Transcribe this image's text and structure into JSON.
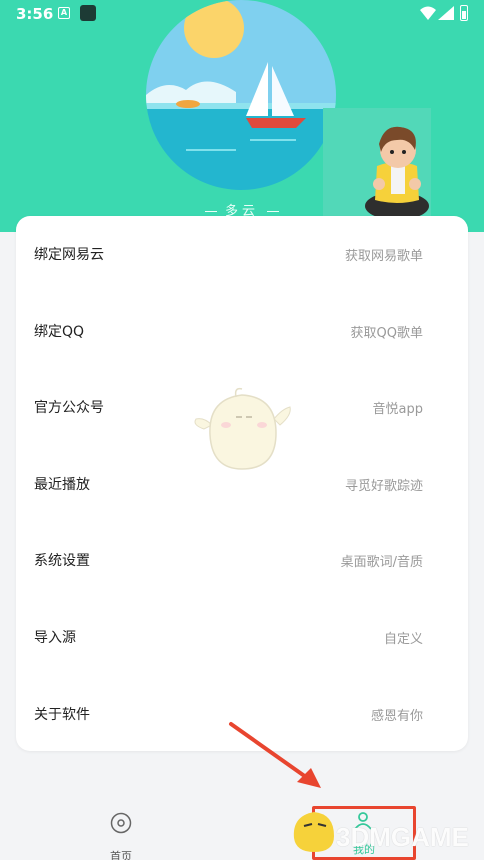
{
  "status_bar": {
    "time": "3:56",
    "notification_letter": "A"
  },
  "weather": {
    "label": "多云"
  },
  "menu": [
    {
      "label": "绑定网易云",
      "value": "获取网易歌单"
    },
    {
      "label": "绑定QQ",
      "value": "获取QQ歌单"
    },
    {
      "label": "官方公众号",
      "value": "音悦app"
    },
    {
      "label": "最近播放",
      "value": "寻觅好歌踪迹"
    },
    {
      "label": "系统设置",
      "value": "桌面歌词/音质"
    },
    {
      "label": "导入源",
      "value": "自定义"
    },
    {
      "label": "关于软件",
      "value": "感恩有你"
    }
  ],
  "bottom_nav": {
    "home_label": "首页",
    "mine_label": "我的"
  },
  "watermark": {
    "text": "3DMGAME"
  },
  "colors": {
    "accent": "#3bd9b0",
    "highlight_box": "#e8452f",
    "arrow": "#e8452f"
  }
}
